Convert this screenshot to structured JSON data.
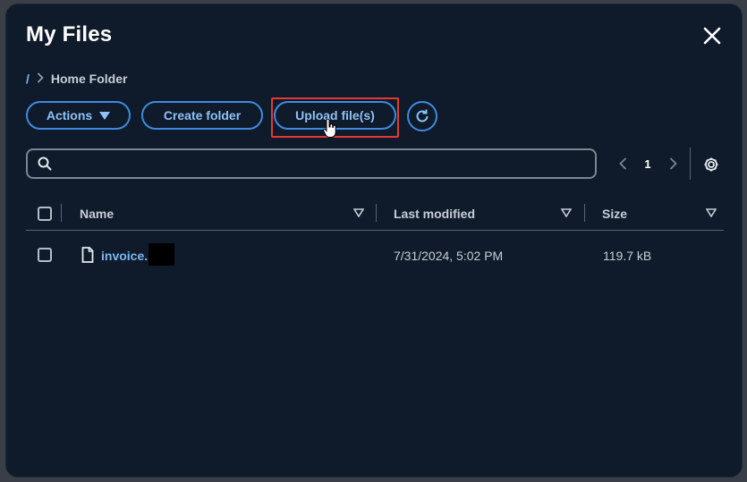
{
  "modal": {
    "title": "My Files"
  },
  "breadcrumb": {
    "root": "/",
    "current": "Home Folder"
  },
  "toolbar": {
    "actions_label": "Actions",
    "create_folder_label": "Create folder",
    "upload_label": "Upload file(s)"
  },
  "search": {
    "placeholder": "",
    "value": ""
  },
  "pagination": {
    "current_page": "1"
  },
  "table": {
    "columns": [
      "Name",
      "Last modified",
      "Size"
    ],
    "rows": [
      {
        "name": "invoice.",
        "last_modified": "7/31/2024, 5:02 PM",
        "size": "119.7 kB"
      }
    ]
  },
  "colors": {
    "background": "#0f1b2a",
    "accent": "#3f8ae0",
    "link": "#7cb7f5",
    "highlight": "#e53935"
  },
  "icons": [
    "close-icon",
    "chevron-right-icon",
    "caret-down-icon",
    "refresh-icon",
    "search-icon",
    "chevron-left-icon",
    "gear-icon",
    "sort-icon",
    "file-icon",
    "hand-cursor-icon"
  ]
}
